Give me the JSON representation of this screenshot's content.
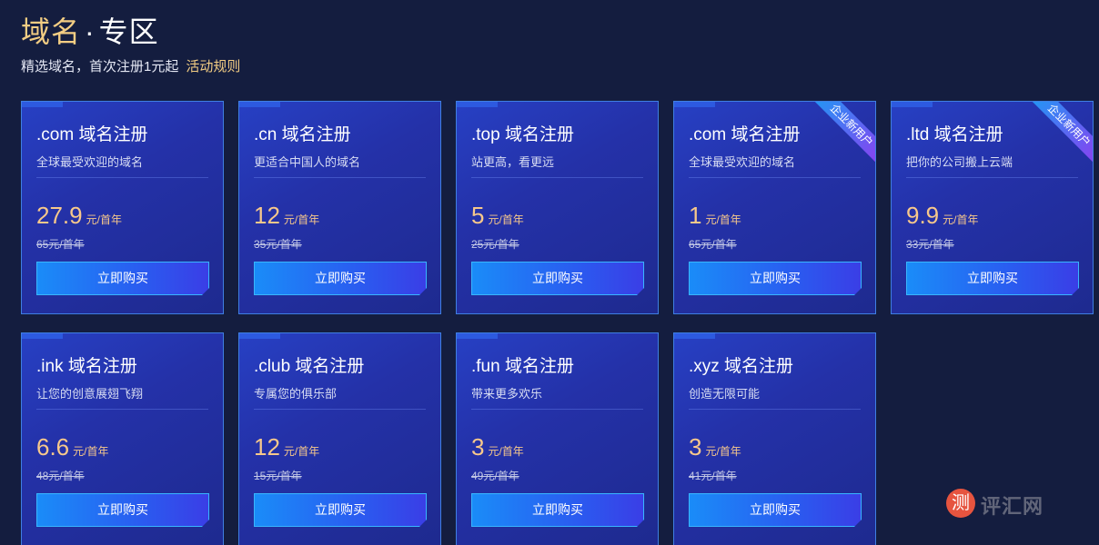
{
  "header": {
    "title_part1": "域名",
    "title_sep": "·",
    "title_part2": "专区",
    "subtitle": "精选域名，首次注册1元起",
    "rules_link": "活动规则"
  },
  "cards": [
    {
      "title": ".com 域名注册",
      "desc": "全球最受欢迎的域名",
      "price": "27.9",
      "unit": "元/首年",
      "orig": "65元/首年",
      "button": "立即购买"
    },
    {
      "title": ".cn 域名注册",
      "desc": "更适合中国人的域名",
      "price": "12",
      "unit": "元/首年",
      "orig": "35元/首年",
      "button": "立即购买"
    },
    {
      "title": ".top 域名注册",
      "desc": "站更高，看更远",
      "price": "5",
      "unit": "元/首年",
      "orig": "25元/首年",
      "button": "立即购买"
    },
    {
      "title": ".com 域名注册",
      "desc": "全球最受欢迎的域名",
      "price": "1",
      "unit": "元/首年",
      "orig": "65元/首年",
      "button": "立即购买",
      "badge": "企业新用户"
    },
    {
      "title": ".ltd 域名注册",
      "desc": "把你的公司搬上云端",
      "price": "9.9",
      "unit": "元/首年",
      "orig": "33元/首年",
      "button": "立即购买",
      "badge": "企业新用户"
    },
    {
      "title": ".ink 域名注册",
      "desc": "让您的创意展翅飞翔",
      "price": "6.6",
      "unit": "元/首年",
      "orig": "48元/首年",
      "button": "立即购买"
    },
    {
      "title": ".club 域名注册",
      "desc": "专属您的俱乐部",
      "price": "12",
      "unit": "元/首年",
      "orig": "15元/首年",
      "button": "立即购买"
    },
    {
      "title": ".fun 域名注册",
      "desc": "带来更多欢乐",
      "price": "3",
      "unit": "元/首年",
      "orig": "49元/首年",
      "button": "立即购买"
    },
    {
      "title": ".xyz 域名注册",
      "desc": "创造无限可能",
      "price": "3",
      "unit": "元/首年",
      "orig": "41元/首年",
      "button": "立即购买"
    }
  ],
  "watermark": {
    "glyph": "测",
    "text": "评汇网"
  },
  "colors": {
    "background": "#141d3f",
    "gold": "#f3cd83",
    "price": "#f7c88b",
    "card": "#2431a8",
    "button": "#1a8cf8"
  }
}
